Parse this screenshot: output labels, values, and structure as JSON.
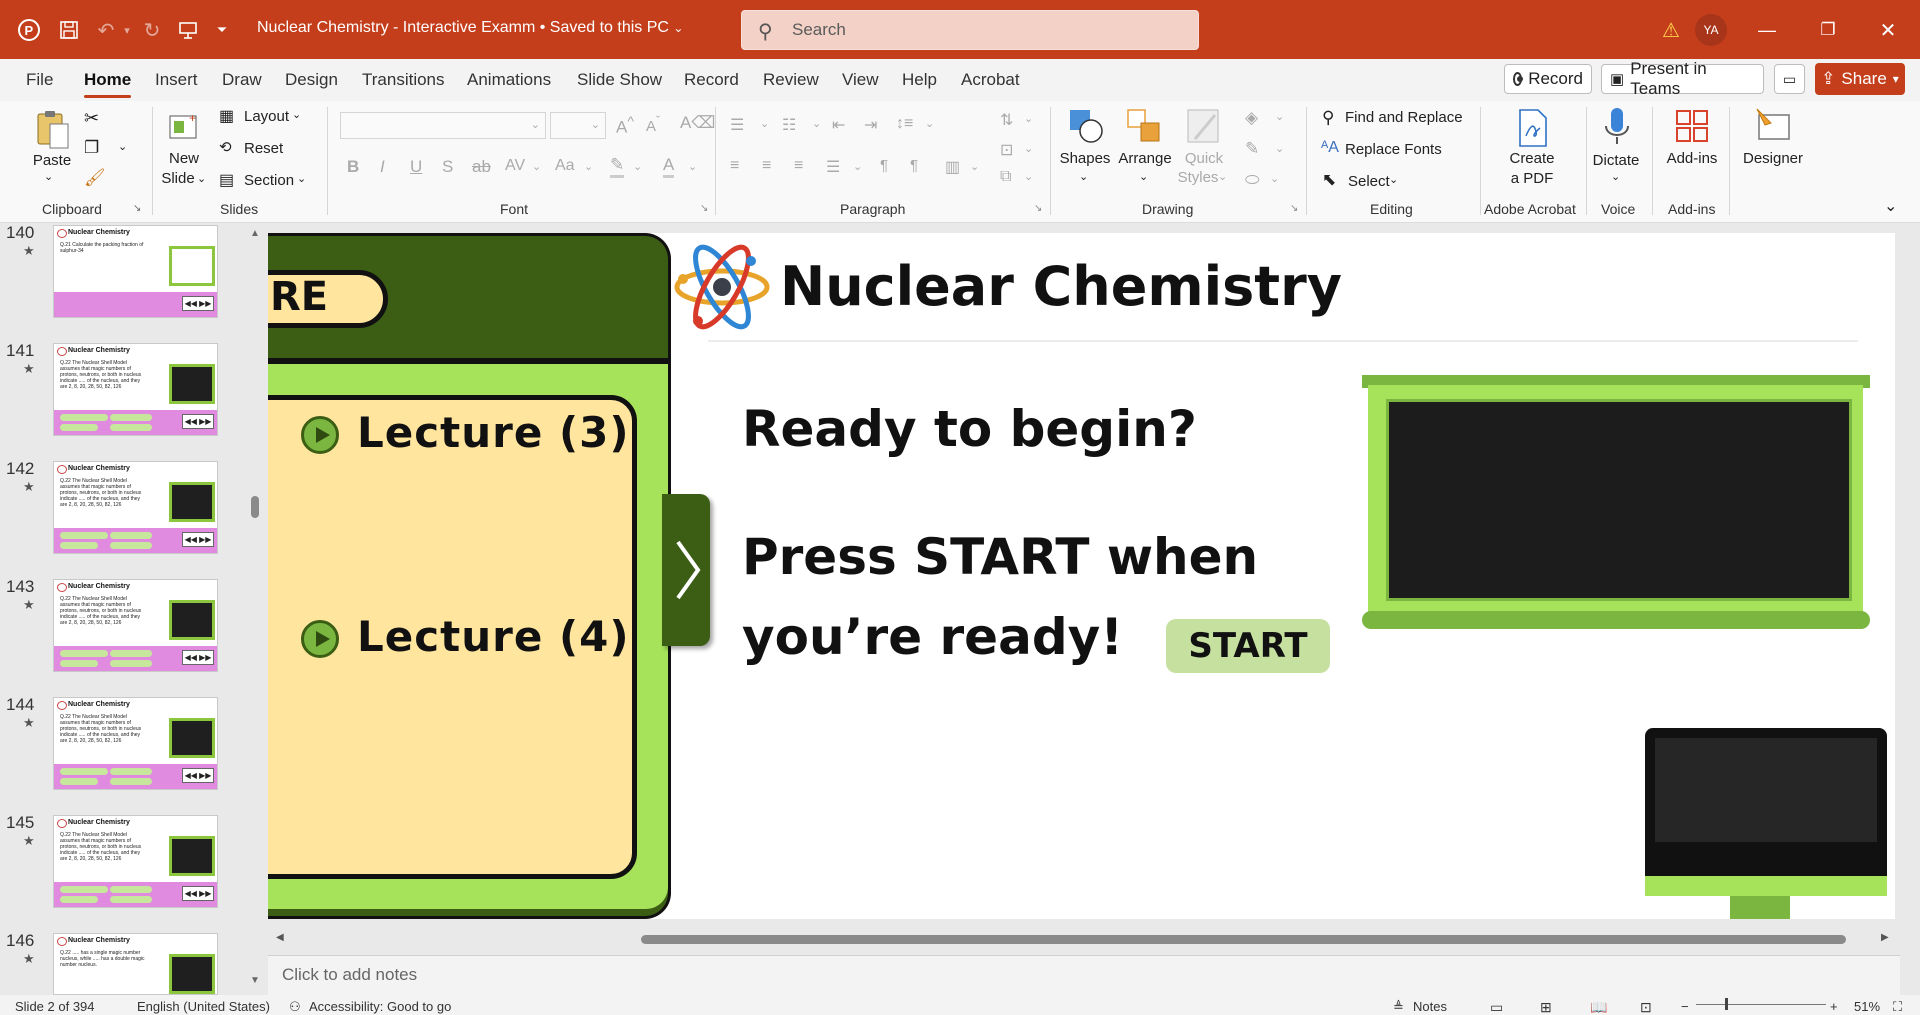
{
  "titlebar": {
    "doc_title": "Nuclear Chemistry - Interactive Examm • Saved to this PC",
    "search_placeholder": "Search",
    "avatar_initials": "YA"
  },
  "tabs": [
    "File",
    "Home",
    "Insert",
    "Draw",
    "Design",
    "Transitions",
    "Animations",
    "Slide Show",
    "Record",
    "Review",
    "View",
    "Help",
    "Acrobat"
  ],
  "tab_buttons": {
    "record": "Record",
    "present": "Present in Teams",
    "share": "Share"
  },
  "ribbon": {
    "clipboard": {
      "paste": "Paste",
      "label": "Clipboard"
    },
    "slides": {
      "new_slide_line1": "New",
      "new_slide_line2": "Slide",
      "layout": "Layout",
      "reset": "Reset",
      "section": "Section",
      "label": "Slides"
    },
    "font": {
      "label": "Font"
    },
    "paragraph": {
      "label": "Paragraph"
    },
    "drawing": {
      "shapes": "Shapes",
      "arrange": "Arrange",
      "quick_styles_line1": "Quick",
      "quick_styles_line2": "Styles",
      "label": "Drawing"
    },
    "editing": {
      "find_replace": "Find and Replace",
      "replace_fonts": "Replace Fonts",
      "select": "Select",
      "label": "Editing"
    },
    "acrobat": {
      "create_pdf_line1": "Create",
      "create_pdf_line2": "a PDF",
      "label": "Adobe Acrobat"
    },
    "voice": {
      "dictate": "Dictate",
      "label": "Voice"
    },
    "addins": {
      "addins": "Add-ins",
      "label": "Add-ins"
    },
    "designer": {
      "designer": "Designer"
    }
  },
  "thumbnails": [
    {
      "num": "140",
      "title": "Nuclear Chemistry",
      "text": "Q.21 Calculate the packing fraction of sulphur-34"
    },
    {
      "num": "141",
      "title": "Nuclear Chemistry",
      "text": "Q.22 The Nuclear Shell Model assumes that magic numbers of protons, neutrons, or both in nucleus indicate ..... of the nucleus, and they are 2, 8, 20, 28, 50, 82, 126"
    },
    {
      "num": "142",
      "title": "Nuclear Chemistry",
      "text": "Q.22 The Nuclear Shell Model assumes that magic numbers of protons, neutrons, or both in nucleus indicate ..... of the nucleus, and they are 2, 8, 20, 28, 50, 82, 126"
    },
    {
      "num": "143",
      "title": "Nuclear Chemistry",
      "text": "Q.22 The Nuclear Shell Model assumes that magic numbers of protons, neutrons, or both in nucleus indicate ..... of the nucleus, and they are 2, 8, 20, 28, 50, 82, 126"
    },
    {
      "num": "144",
      "title": "Nuclear Chemistry",
      "text": "Q.22 The Nuclear Shell Model assumes that magic numbers of protons, neutrons, or both in nucleus indicate ..... of the nucleus, and they are 2, 8, 20, 28, 50, 82, 126"
    },
    {
      "num": "145",
      "title": "Nuclear Chemistry",
      "text": "Q.22 The Nuclear Shell Model assumes that magic numbers of protons, neutrons, or both in nucleus indicate ..... of the nucleus, and they are 2, 8, 20, 28, 50, 82, 126"
    },
    {
      "num": "146",
      "title": "Nuclear Chemistry",
      "text": "Q.22 ..... has a single magic number nucleus, while ..... has a double magic number nucleus."
    }
  ],
  "slide": {
    "menu_partial": "RE",
    "lecture_3": "Lecture (3)",
    "lecture_4": "Lecture (4)",
    "title": "Nuclear Chemistry",
    "ready": "Ready to begin?",
    "press_line1": "Press START when",
    "press_line2": "you’re ready!",
    "start": "START"
  },
  "notes": {
    "placeholder": "Click to add notes"
  },
  "status": {
    "slide_info": "Slide 2 of 394",
    "language": "English (United States)",
    "accessibility": "Accessibility: Good to go",
    "notes": "Notes",
    "zoom": "51%"
  },
  "colors": {
    "accent": "#c43e1c",
    "slide_green_dark": "#3b5e14",
    "slide_green_light": "#a6e35a",
    "slide_cream": "#ffe59e",
    "start_button": "#c6e0a0"
  }
}
